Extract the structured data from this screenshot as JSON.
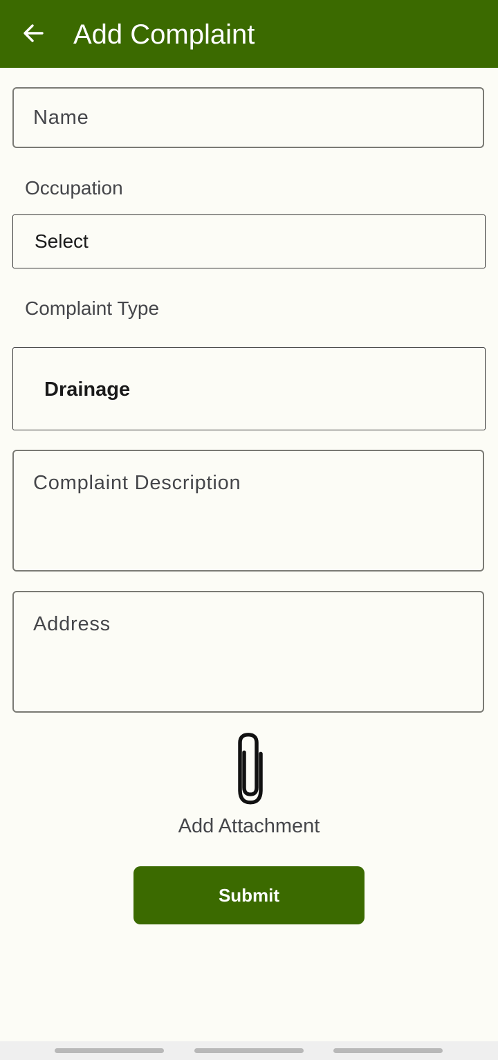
{
  "app_bar": {
    "title": "Add Complaint",
    "back_icon": "arrow-left-icon",
    "background": "#3b6a00"
  },
  "form": {
    "name_placeholder": "Name",
    "occupation_label": "Occupation",
    "occupation_value": "Select",
    "complaint_type_label": "Complaint Type",
    "complaint_type_value": "Drainage",
    "description_placeholder": "Complaint Description",
    "address_placeholder": "Address"
  },
  "attachment": {
    "icon": "paperclip-icon",
    "label": "Add Attachment"
  },
  "submit": {
    "label": "Submit",
    "background": "#3b6a00"
  }
}
